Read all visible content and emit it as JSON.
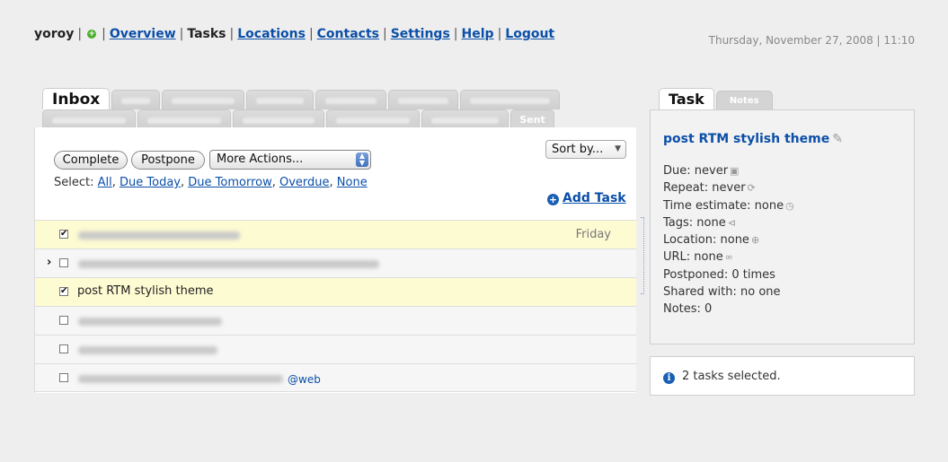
{
  "header": {
    "username": "yoroy",
    "nav": {
      "overview": "Overview",
      "tasks": "Tasks",
      "locations": "Locations",
      "contacts": "Contacts",
      "settings": "Settings",
      "help": "Help",
      "logout": "Logout"
    },
    "datetime": "Thursday, November 27, 2008 | 11:10"
  },
  "lists": {
    "active_tab": "Inbox",
    "last_tab": "Sent"
  },
  "toolbar": {
    "complete": "Complete",
    "postpone": "Postpone",
    "more_actions": "More Actions...",
    "sort_by": "Sort by...",
    "select_label": "Select:",
    "select_all": "All",
    "select_due_today": "Due Today",
    "select_due_tomorrow": "Due Tomorrow",
    "select_overdue": "Overdue",
    "select_none": "None",
    "add_task": "Add Task"
  },
  "tasks": [
    {
      "checked": true,
      "selected": true,
      "due": "Friday"
    },
    {
      "checked": false,
      "selected": false
    },
    {
      "checked": true,
      "selected": true,
      "name": "post RTM stylish theme"
    },
    {
      "checked": false,
      "selected": false
    },
    {
      "checked": false,
      "selected": false
    },
    {
      "checked": false,
      "selected": false,
      "tag": "@web"
    }
  ],
  "detail": {
    "tab_task": "Task",
    "tab_notes": "Notes",
    "title": "post RTM stylish theme",
    "fields": {
      "due": "Due: never",
      "repeat": "Repeat: never",
      "time_estimate": "Time estimate: none",
      "tags": "Tags: none",
      "location": "Location: none",
      "url": "URL: none",
      "postponed": "Postponed: 0 times",
      "shared_with": "Shared with: no one",
      "notes": "Notes: 0"
    },
    "status": "2 tasks selected."
  }
}
